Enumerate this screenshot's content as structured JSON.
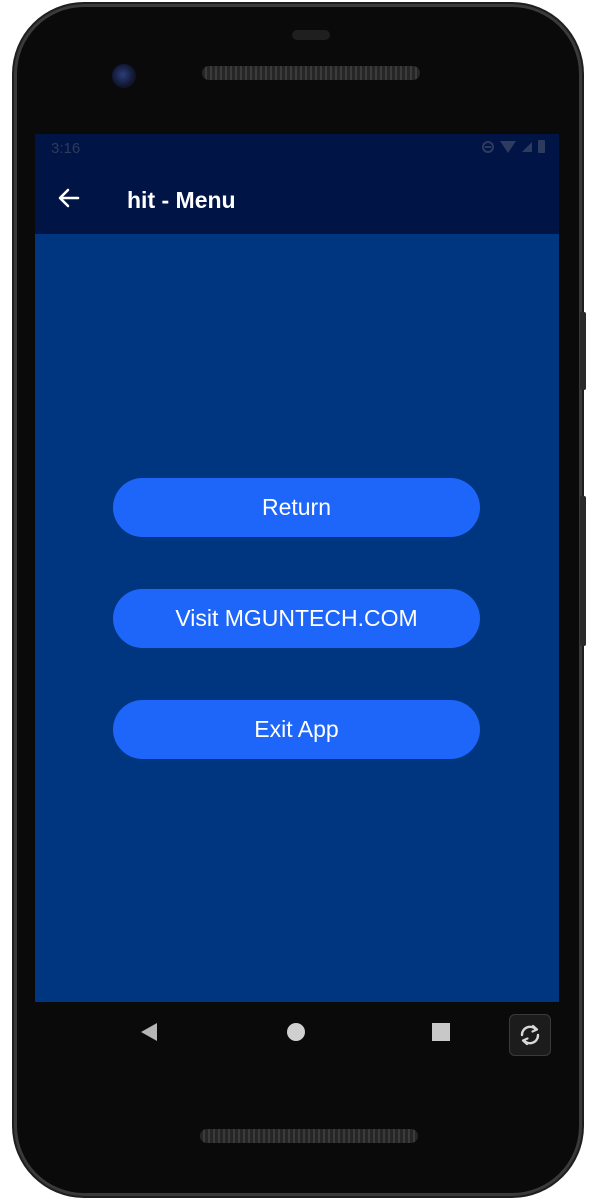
{
  "status_bar": {
    "time": "3:16",
    "icons": [
      "do-not-disturb-icon",
      "wifi-icon",
      "signal-icon",
      "battery-icon"
    ]
  },
  "app_bar": {
    "title": "hit - Menu",
    "back_icon": "arrow-left-icon"
  },
  "menu": {
    "buttons": [
      {
        "label": "Return"
      },
      {
        "label": "Visit MGUNTECH.COM"
      },
      {
        "label": "Exit App"
      }
    ]
  },
  "nav_bar": {
    "icons": [
      "nav-back-icon",
      "nav-home-icon",
      "nav-recents-icon",
      "rotate-icon"
    ]
  },
  "colors": {
    "screen_background": "#003580",
    "app_bar_background": "#001446",
    "button_background": "#1d66f9",
    "button_text": "#ffffff"
  }
}
